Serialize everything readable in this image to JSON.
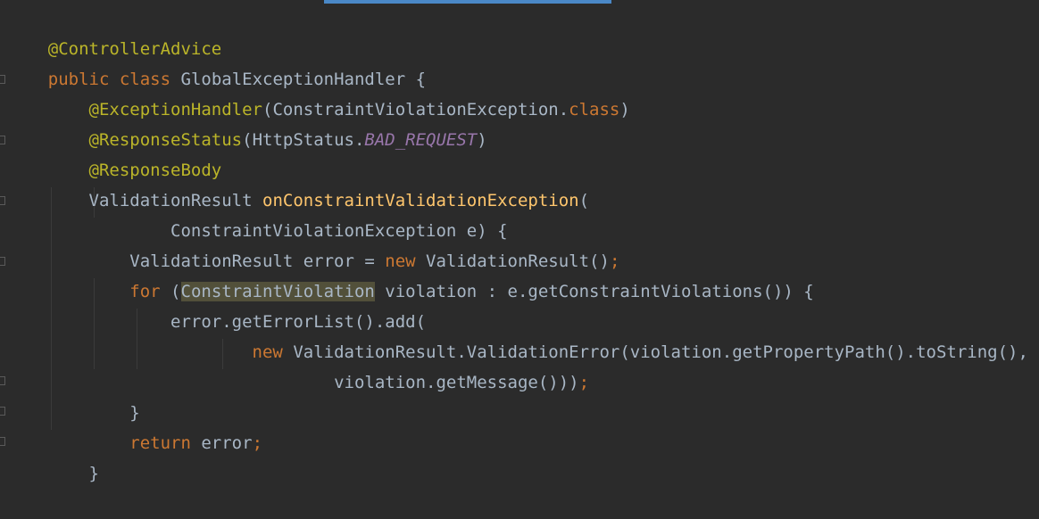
{
  "editor": {
    "lines": {
      "l1": {
        "ann": "@ControllerAdvice"
      },
      "l2": {
        "kw1": "public",
        "kw2": "class",
        "name": "GlobalExceptionHandler",
        "brace": "{"
      },
      "l3": {
        "ann": "@ExceptionHandler",
        "p1": "(ConstraintViolationException.",
        "kw": "class",
        "p2": ")"
      },
      "l4": {
        "ann": "@ResponseStatus",
        "p1": "(HttpStatus.",
        "const": "BAD_REQUEST",
        "p2": ")"
      },
      "l5": {
        "ann": "@ResponseBody"
      },
      "l6": {
        "type": "ValidationResult",
        "fn": "onConstraintValidationException",
        "p": "("
      },
      "l7": {
        "text": "ConstraintViolationException e) {"
      },
      "l8": {
        "t1": "ValidationResult error = ",
        "kw": "new",
        "t2": " ValidationResult()",
        "semi": ";"
      },
      "l9": {
        "kw": "for",
        "t1": " (",
        "hl": "ConstraintViolation",
        "t2": " violation : e.getConstraintViolations()) {"
      },
      "l10": {
        "text": "error.getErrorList().add("
      },
      "l11": {
        "kw": "new",
        "text": " ValidationResult.ValidationError(violation.getPropertyPath().toString(),"
      },
      "l12": {
        "text": "violation.getMessage()))",
        "semi": ";"
      },
      "l13": {
        "text": "}"
      },
      "l14": {
        "kw": "return",
        "text": " error",
        "semi": ";"
      },
      "l15": {
        "text": "}"
      }
    }
  }
}
